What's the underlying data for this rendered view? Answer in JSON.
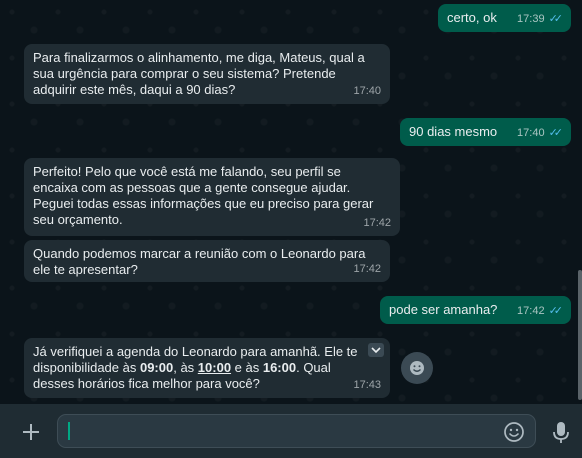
{
  "messages": [
    {
      "dir": "out",
      "text": "certo, ok",
      "time": "17:39"
    },
    {
      "dir": "in",
      "text": "Para finalizarmos o alinhamento, me diga, Mateus, qual a\nsua urgência para comprar o seu sistema? Pretende\nadquirir este mês, daqui a 90 dias?",
      "time": "17:40"
    },
    {
      "dir": "out",
      "text": "90 dias mesmo",
      "time": "17:40"
    },
    {
      "dir": "in",
      "text": "Perfeito! Pelo que você está me falando, seu perfil se\nencaixa com as pessoas que a gente consegue ajudar.\nPeguei todas essas informações que eu preciso para gerar\nseu orçamento.",
      "time": "17:42"
    },
    {
      "dir": "in",
      "text": "Quando podemos marcar a reunião com o Leonardo para\nele te apresentar?",
      "time": "17:42"
    },
    {
      "dir": "out",
      "text": "pode ser amanha?",
      "time": "17:42"
    },
    {
      "dir": "in",
      "time": "17:43",
      "parts": {
        "p1": "Já verifiquei a agenda do Leonardo para amanhã. Ele te",
        "p2": "disponibilidade às ",
        "t1": "09:00",
        "p3": ", às ",
        "t2": "10:00",
        "p4": " e às ",
        "t3": "16:00",
        "p5": ". Qual",
        "p6": "desses horários fica melhor para você?"
      }
    }
  ],
  "icons": {
    "read": "double-check-icon",
    "attach": "plus-icon",
    "emoji": "emoji-icon",
    "mic": "microphone-icon",
    "menu": "chevron-down-icon",
    "react": "reaction-emoji-icon"
  },
  "colors": {
    "background": "#0b141a",
    "incoming": "#202c33",
    "outgoing": "#005c4b",
    "read_ticks": "#53bdeb",
    "footer": "#1f2c33"
  },
  "composer": {
    "value": ""
  }
}
